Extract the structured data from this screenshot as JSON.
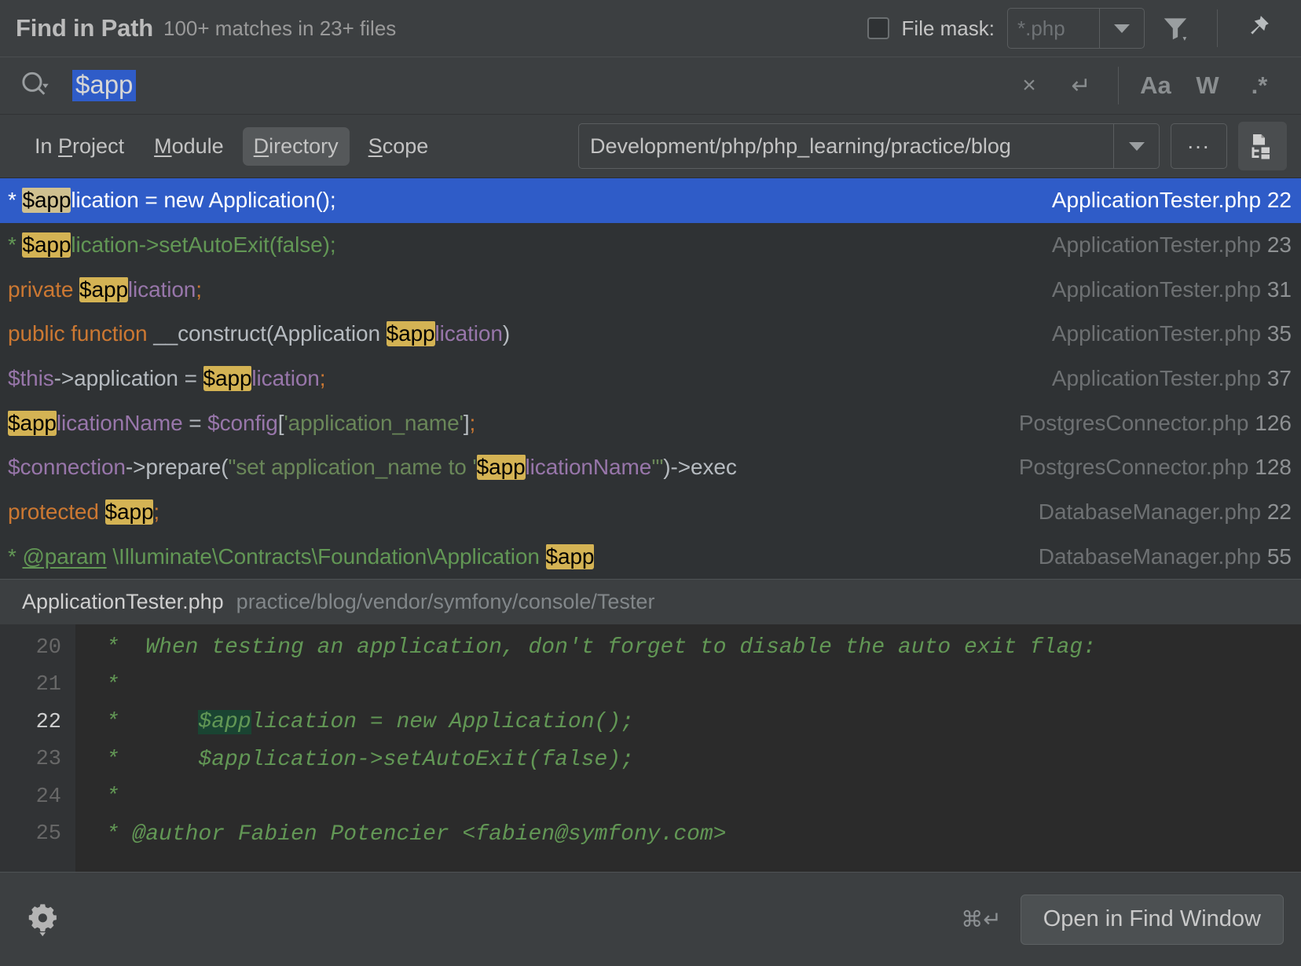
{
  "header": {
    "title": "Find in Path",
    "match_summary": "100+ matches in 23+ files",
    "file_mask_label": "File mask:",
    "file_mask_value": "*.php",
    "filter_icon": "filter-icon",
    "pin_icon": "pin-icon"
  },
  "search": {
    "query": "$app",
    "clear_label": "×",
    "newline_label": "↵",
    "match_case_label": "Aa",
    "words_label": "W",
    "regex_label": ".*"
  },
  "scope": {
    "tabs": [
      {
        "prefix": "In ",
        "mnemonic": "P",
        "suffix": "roject",
        "selected": false
      },
      {
        "prefix": "",
        "mnemonic": "M",
        "suffix": "odule",
        "selected": false
      },
      {
        "prefix": "",
        "mnemonic": "D",
        "suffix": "irectory",
        "selected": true
      },
      {
        "prefix": "",
        "mnemonic": "S",
        "suffix": "cope",
        "selected": false
      }
    ],
    "path": "Development/php/php_learning/practice/blog",
    "browse_label": "...",
    "recursive_icon": "recursive-search-icon"
  },
  "results": [
    {
      "selected": true,
      "file": "ApplicationTester.php",
      "line": "22",
      "parts": [
        {
          "t": "*     ",
          "c": "cmt"
        },
        {
          "t": "$app",
          "c": "hl"
        },
        {
          "t": "lication = new Application();",
          "c": "cmt"
        }
      ]
    },
    {
      "selected": false,
      "file": "ApplicationTester.php",
      "line": "23",
      "parts": [
        {
          "t": "*     ",
          "c": "cmt"
        },
        {
          "t": "$app",
          "c": "hl"
        },
        {
          "t": "lication->setAutoExit(false);",
          "c": "cmt"
        }
      ]
    },
    {
      "selected": false,
      "file": "ApplicationTester.php",
      "line": "31",
      "parts": [
        {
          "t": "private ",
          "c": "kw"
        },
        {
          "t": "$app",
          "c": "hl"
        },
        {
          "t": "lication",
          "c": "var"
        },
        {
          "t": ";",
          "c": "kw"
        }
      ]
    },
    {
      "selected": false,
      "file": "ApplicationTester.php",
      "line": "35",
      "parts": [
        {
          "t": "public function ",
          "c": "kw"
        },
        {
          "t": "__construct(Application ",
          "c": "plain"
        },
        {
          "t": "$app",
          "c": "hl"
        },
        {
          "t": "lication",
          "c": "var"
        },
        {
          "t": ")",
          "c": "plain"
        }
      ]
    },
    {
      "selected": false,
      "file": "ApplicationTester.php",
      "line": "37",
      "parts": [
        {
          "t": "$this",
          "c": "var"
        },
        {
          "t": "->application = ",
          "c": "plain"
        },
        {
          "t": "$app",
          "c": "hl"
        },
        {
          "t": "lication",
          "c": "var"
        },
        {
          "t": ";",
          "c": "kw"
        }
      ]
    },
    {
      "selected": false,
      "file": "PostgresConnector.php",
      "line": "126",
      "parts": [
        {
          "t": "$app",
          "c": "hl"
        },
        {
          "t": "licationName ",
          "c": "var"
        },
        {
          "t": "= ",
          "c": "plain"
        },
        {
          "t": "$config",
          "c": "var"
        },
        {
          "t": "[",
          "c": "plain"
        },
        {
          "t": "'application_name'",
          "c": "str"
        },
        {
          "t": "]",
          "c": "plain"
        },
        {
          "t": ";",
          "c": "kw"
        }
      ]
    },
    {
      "selected": false,
      "file": "PostgresConnector.php",
      "line": "128",
      "parts": [
        {
          "t": "$connection",
          "c": "var"
        },
        {
          "t": "->",
          "c": "plain"
        },
        {
          "t": "prepare",
          "c": "fn"
        },
        {
          "t": "(",
          "c": "plain"
        },
        {
          "t": "\"set application_name to '",
          "c": "str"
        },
        {
          "t": "$app",
          "c": "hl"
        },
        {
          "t": "licationName",
          "c": "var"
        },
        {
          "t": "'\"",
          "c": "str"
        },
        {
          "t": ")->exec",
          "c": "plain"
        }
      ]
    },
    {
      "selected": false,
      "file": "DatabaseManager.php",
      "line": "22",
      "parts": [
        {
          "t": "protected ",
          "c": "kw"
        },
        {
          "t": "$app",
          "c": "hl"
        },
        {
          "t": ";",
          "c": "kw"
        }
      ]
    },
    {
      "selected": false,
      "file": "DatabaseManager.php",
      "line": "55",
      "parts": [
        {
          "t": "* ",
          "c": "cmt"
        },
        {
          "t": "@param",
          "c": "doctag"
        },
        {
          "t": "  \\Illuminate\\Contracts\\Foundation\\Application  ",
          "c": "cmt"
        },
        {
          "t": "$app",
          "c": "hl"
        }
      ]
    }
  ],
  "preview": {
    "file_name": "ApplicationTester.php",
    "file_path": "practice/blog/vendor/symfony/console/Tester",
    "lines": [
      {
        "number": "20",
        "current": false,
        "parts": [
          {
            "t": " *  When testing an application, don't forget to disable the auto exit flag:",
            "hl": false
          }
        ]
      },
      {
        "number": "21",
        "current": false,
        "parts": [
          {
            "t": " *",
            "hl": false
          }
        ]
      },
      {
        "number": "22",
        "current": true,
        "parts": [
          {
            "t": " *      ",
            "hl": false
          },
          {
            "t": "$app",
            "hl": true
          },
          {
            "t": "lication = new Application();",
            "hl": false
          }
        ]
      },
      {
        "number": "23",
        "current": false,
        "parts": [
          {
            "t": " *      $application->setAutoExit(false);",
            "hl": false
          }
        ]
      },
      {
        "number": "24",
        "current": false,
        "parts": [
          {
            "t": " *",
            "hl": false
          }
        ]
      },
      {
        "number": "25",
        "current": false,
        "parts": [
          {
            "t": " * @author Fabien Potencier <fabien@symfony.com>",
            "hl": false
          }
        ]
      }
    ]
  },
  "bottom": {
    "settings_icon": "gear-icon",
    "shortcut": "⌘↵",
    "open_button": "Open in Find Window"
  }
}
